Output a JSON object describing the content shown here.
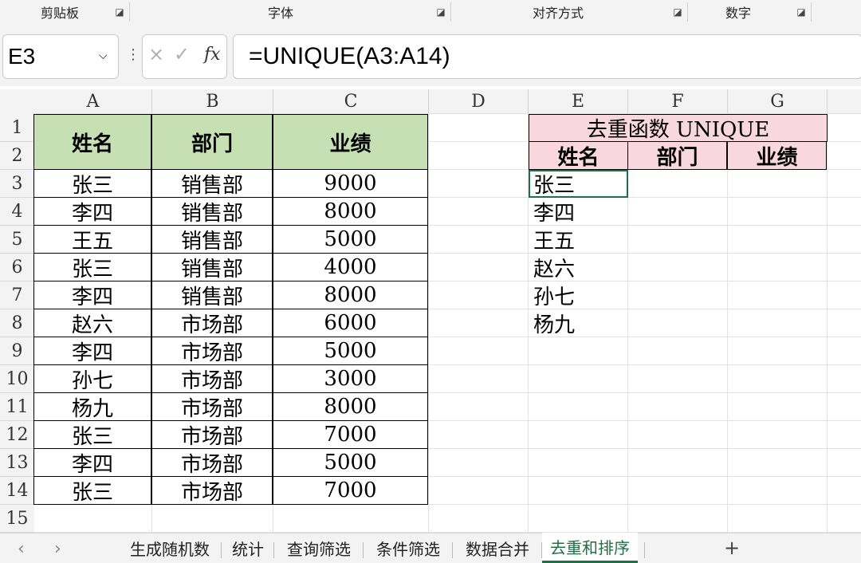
{
  "ribbon": {
    "groups": [
      "剪贴板",
      "字体",
      "对齐方式",
      "数字"
    ]
  },
  "formula_bar": {
    "cell_ref": "E3",
    "formula": "=UNIQUE(A3:A14)",
    "cancel_icon": "×",
    "enter_icon": "✓",
    "fx_icon": "fx"
  },
  "columns": [
    "A",
    "B",
    "C",
    "D",
    "E",
    "F",
    "G"
  ],
  "rows": [
    "1",
    "2",
    "3",
    "4",
    "5",
    "6",
    "7",
    "8",
    "9",
    "10",
    "11",
    "12",
    "13",
    "14",
    "15"
  ],
  "source_table": {
    "headers": [
      "姓名",
      "部门",
      "业绩"
    ],
    "rows": [
      [
        "张三",
        "销售部",
        "9000"
      ],
      [
        "李四",
        "销售部",
        "8000"
      ],
      [
        "王五",
        "销售部",
        "5000"
      ],
      [
        "张三",
        "销售部",
        "4000"
      ],
      [
        "李四",
        "销售部",
        "8000"
      ],
      [
        "赵六",
        "市场部",
        "6000"
      ],
      [
        "李四",
        "市场部",
        "5000"
      ],
      [
        "孙七",
        "市场部",
        "3000"
      ],
      [
        "杨九",
        "市场部",
        "8000"
      ],
      [
        "张三",
        "市场部",
        "7000"
      ],
      [
        "李四",
        "市场部",
        "5000"
      ],
      [
        "张三",
        "市场部",
        "7000"
      ]
    ],
    "header_color": "#c6e0b4"
  },
  "result_table": {
    "title": "去重函数 UNIQUE",
    "headers": [
      "姓名",
      "部门",
      "业绩"
    ],
    "values": [
      "张三",
      "李四",
      "王五",
      "赵六",
      "孙七",
      "杨九"
    ],
    "header_color": "#f8d7de"
  },
  "sheet_tabs": {
    "tabs": [
      "生成随机数",
      "统计",
      "查询筛选",
      "条件筛选",
      "数据合并",
      "去重和排序"
    ],
    "active": "去重和排序",
    "add_label": "+",
    "prev_label": "‹",
    "next_label": "›",
    "accent": "#1e7145"
  }
}
